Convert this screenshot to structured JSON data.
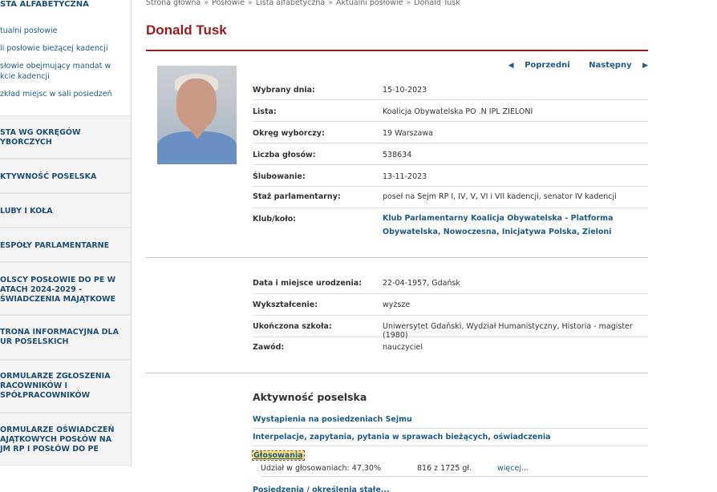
{
  "sidebar": {
    "section_title": "STA ALFABETYCZNA",
    "sub_items": [
      "tualni posłowie",
      "li posłowie bieżącej kadencji",
      "słowie obejmujący mandat w",
      "kcie kadencji",
      "zkład miejsc w sali posiedzeń"
    ],
    "boxes": [
      "STA WG OKRĘGÓW\nYBORCZYCH",
      "KTYWNOŚĆ POSELSKA",
      "LUBY I KOŁA",
      "ESPOŁY PARLAMENTARNE",
      "OLSCY POSŁOWIE DO PE W\nATACH 2024-2029 -\nŚWIADCZENIA MAJĄTKOWE",
      "TRONA INFORMACYJNA DLA\nUR POSELSKICH",
      "ORMULARZE ZGŁOSZENIA\nRACOWNIKÓW I\nSPÓŁPRACOWNIKÓW",
      "ORMULARZE OŚWIADCZEŃ\nAJĄTKOWYCH POSŁÓW NA\nJM RP I POSŁÓW DO PE"
    ]
  },
  "breadcrumb": [
    "Strona główna",
    "Posłowie",
    "Lista alfabetyczna",
    "Aktualni posłowie",
    "Donald Tusk"
  ],
  "breadcrumb_sep": "»",
  "title": "Donald Tusk",
  "nav": {
    "prev": "Poprzedni",
    "next": "Następny"
  },
  "info": [
    {
      "label": "Wybrany dnia:",
      "value": "15-10-2023"
    },
    {
      "label": "Lista:",
      "value": "Koalicja Obywatelska PO .N IPL ZIELONI"
    },
    {
      "label": "Okręg wyborczy:",
      "value": "19  Warszawa"
    },
    {
      "label": "Liczba głosów:",
      "value": "538634"
    },
    {
      "label": "Ślubowanie:",
      "value": "13-11-2023"
    },
    {
      "label": "Staż parlamentarny:",
      "value": "poseł na Sejm RP I, IV, V, VI i VII kadencji, senator IV kadencji"
    },
    {
      "label": "Klub/koło:",
      "value": "Klub Parlamentarny Koalicja Obywatelska - Platforma Obywatelska, Nowoczesna, Inicjatywa Polska, Zieloni"
    }
  ],
  "personal": [
    {
      "label": "Data i miejsce urodzenia:",
      "value": "22-04-1957, Gdańsk"
    },
    {
      "label": "Wykształcenie:",
      "value": "wyższe"
    },
    {
      "label": "Ukończona szkoła:",
      "value": "Uniwersytet Gdański, Wydział Humanistyczny, Historia - magister (1980)"
    },
    {
      "label": "Zawód:",
      "value": "nauczyciel"
    }
  ],
  "activity": {
    "heading": "Aktywność poselska",
    "links": [
      "Wystąpienia na posiedzeniach Sejmu",
      "Interpelacje, zapytania, pytania w sprawach bieżących, oświadczenia"
    ],
    "voting_label": "Głosowania",
    "voting_share": "Udział w głosowaniach: 47.30%",
    "voting_count": "816 z 1725 gł.",
    "more": "więcej...",
    "cut_text": "Posiedzenia / określenia stałe..."
  },
  "colors": {
    "accent": "#9a1b1f",
    "link": "#1f5b86"
  }
}
